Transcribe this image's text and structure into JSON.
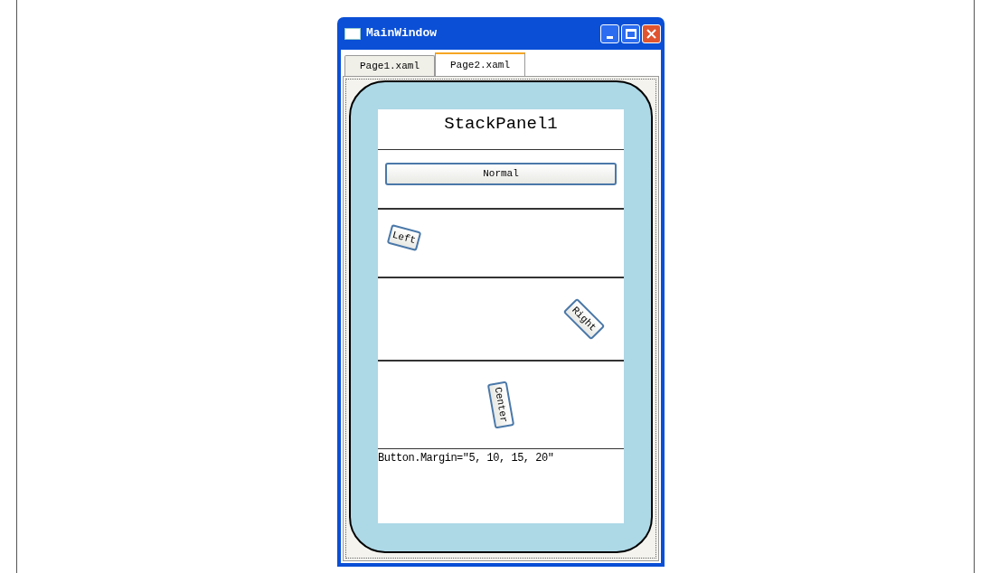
{
  "window": {
    "title": "MainWindow"
  },
  "tabs": [
    {
      "label": "Page1.xaml",
      "selected": false
    },
    {
      "label": "Page2.xaml",
      "selected": true
    }
  ],
  "panel": {
    "title": "StackPanel1",
    "buttons": [
      {
        "label": "Normal",
        "kind": "normal"
      },
      {
        "label": "Left",
        "kind": "left"
      },
      {
        "label": "Right",
        "kind": "right"
      },
      {
        "label": "Center",
        "kind": "center"
      }
    ],
    "caption": "Button.Margin=\"5, 10, 15, 20\""
  }
}
